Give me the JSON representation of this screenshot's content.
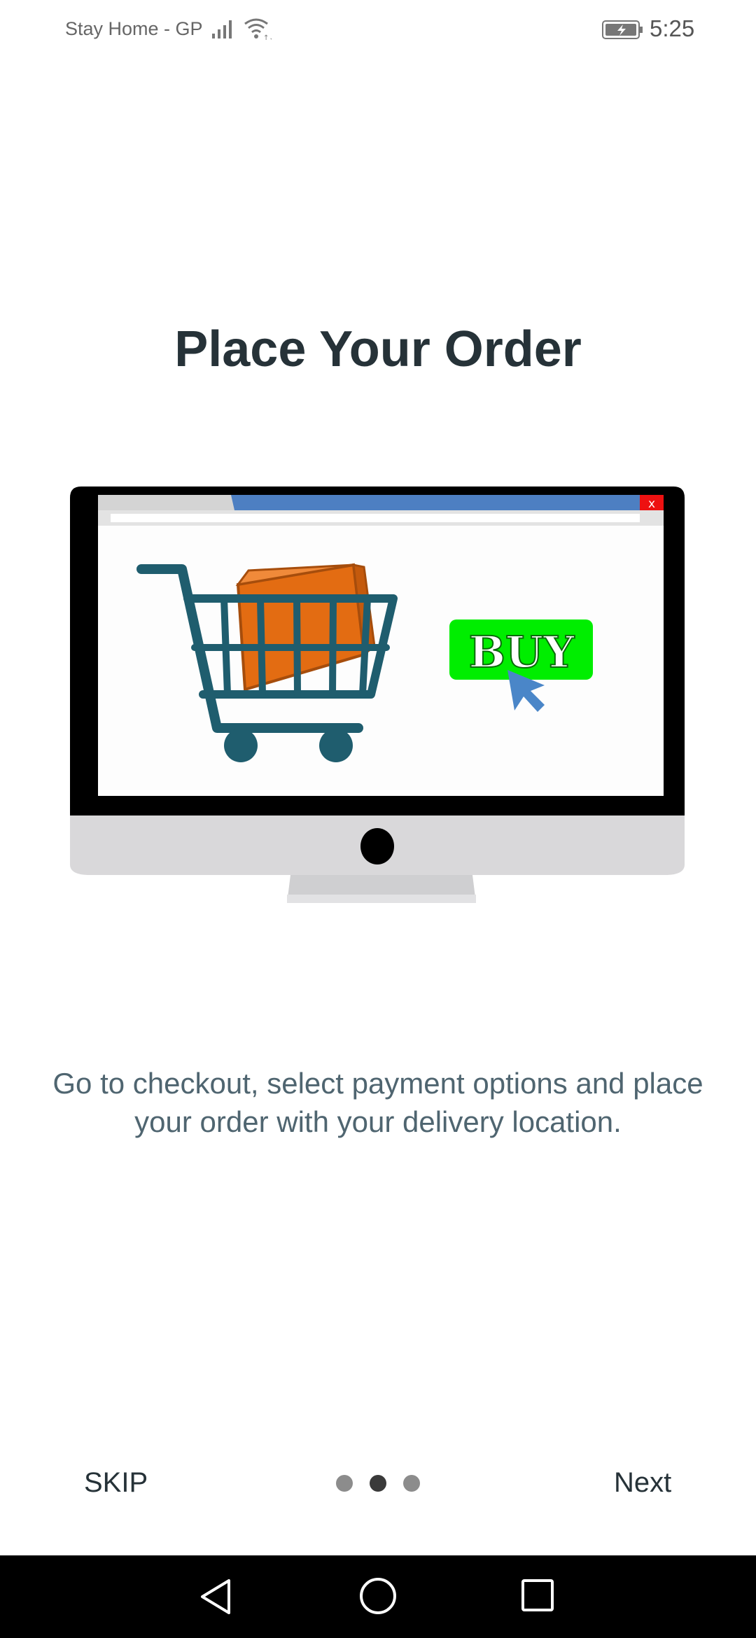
{
  "status_bar": {
    "carrier": "Stay Home - GP",
    "time": "5:25",
    "icons": [
      "signal-icon",
      "wifi-icon",
      "battery-charging-icon"
    ]
  },
  "onboarding": {
    "title": "Place Your Order",
    "illustration": {
      "button_text": "BUY",
      "close_text": "x",
      "icons": [
        "monitor-icon",
        "shopping-cart-icon",
        "box-icon",
        "cursor-icon"
      ]
    },
    "description": "Go to checkout, select payment options and place your order with your delivery location."
  },
  "footer": {
    "skip_label": "SKIP",
    "next_label": "Next",
    "page_indicator": {
      "total": 3,
      "current": 2
    }
  },
  "nav_bar": {
    "icons": [
      "back-icon",
      "home-icon",
      "recents-icon"
    ]
  },
  "colors": {
    "title": "#263238",
    "description": "#4f6570",
    "buy_button": "#00ee00",
    "box": "#e36c12",
    "cart": "#1f5d6e",
    "nav_bar": "#000000"
  }
}
